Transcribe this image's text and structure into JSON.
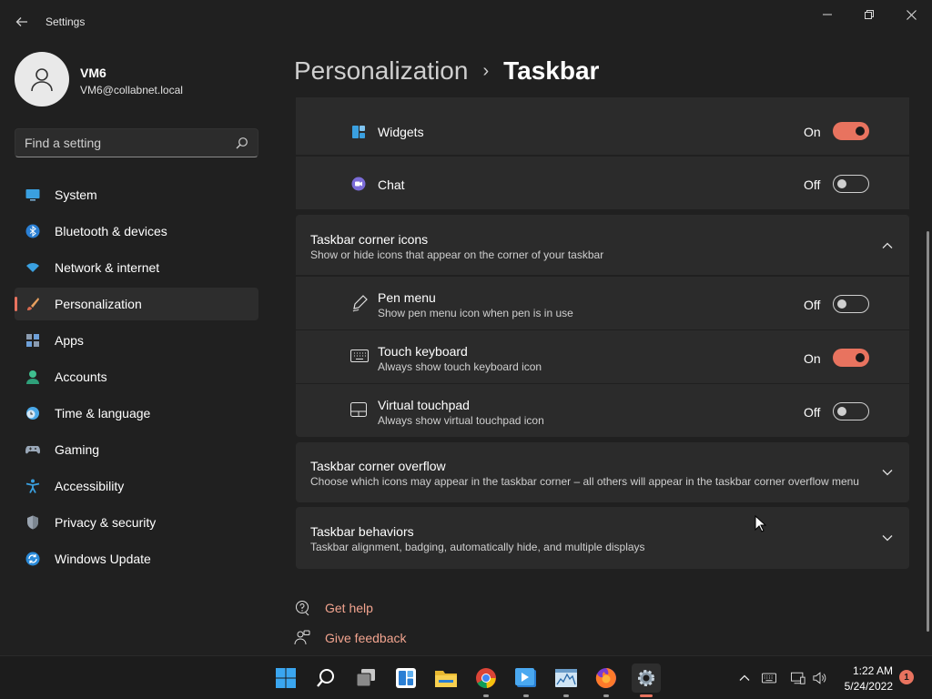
{
  "window": {
    "app_title": "Settings"
  },
  "profile": {
    "name": "VM6",
    "email": "VM6@collabnet.local"
  },
  "search": {
    "placeholder": "Find a setting"
  },
  "sidebar": {
    "items": [
      {
        "label": "System",
        "icon": "monitor-icon"
      },
      {
        "label": "Bluetooth & devices",
        "icon": "bluetooth-icon"
      },
      {
        "label": "Network & internet",
        "icon": "wifi-icon"
      },
      {
        "label": "Personalization",
        "icon": "brush-icon",
        "active": true
      },
      {
        "label": "Apps",
        "icon": "apps-icon"
      },
      {
        "label": "Accounts",
        "icon": "person-icon"
      },
      {
        "label": "Time & language",
        "icon": "clock-globe-icon"
      },
      {
        "label": "Gaming",
        "icon": "gamepad-icon"
      },
      {
        "label": "Accessibility",
        "icon": "accessibility-icon"
      },
      {
        "label": "Privacy & security",
        "icon": "shield-icon"
      },
      {
        "label": "Windows Update",
        "icon": "update-icon"
      }
    ]
  },
  "header": {
    "parent": "Personalization",
    "separator": "›",
    "current": "Taskbar"
  },
  "taskbar_items": {
    "widgets": {
      "label": "Widgets",
      "state": "On",
      "on": true
    },
    "chat": {
      "label": "Chat",
      "state": "Off",
      "on": false
    }
  },
  "corner_icons": {
    "title": "Taskbar corner icons",
    "subtitle": "Show or hide icons that appear on the corner of your taskbar",
    "expanded": true,
    "items": [
      {
        "label": "Pen menu",
        "desc": "Show pen menu icon when pen is in use",
        "state": "Off",
        "on": false,
        "icon": "pen-icon"
      },
      {
        "label": "Touch keyboard",
        "desc": "Always show touch keyboard icon",
        "state": "On",
        "on": true,
        "icon": "keyboard-icon"
      },
      {
        "label": "Virtual touchpad",
        "desc": "Always show virtual touchpad icon",
        "state": "Off",
        "on": false,
        "icon": "touchpad-icon"
      }
    ]
  },
  "corner_overflow": {
    "title": "Taskbar corner overflow",
    "subtitle": "Choose which icons may appear in the taskbar corner – all others will appear in the taskbar corner overflow menu"
  },
  "behaviors": {
    "title": "Taskbar behaviors",
    "subtitle": "Taskbar alignment, badging, automatically hide, and multiple displays"
  },
  "help": {
    "get_help": "Get help",
    "give_feedback": "Give feedback"
  },
  "system_tray": {
    "time": "1:22 AM",
    "date": "5/24/2022",
    "notifications": "1"
  },
  "colors": {
    "accent": "#e8735f",
    "background": "#202020",
    "card": "#2b2b2b"
  }
}
